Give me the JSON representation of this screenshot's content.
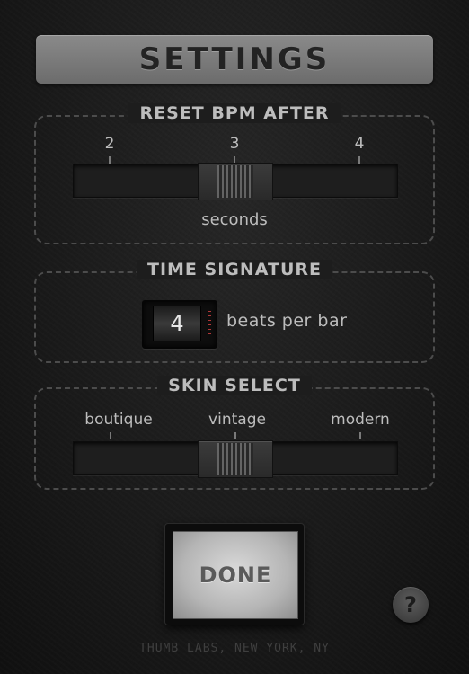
{
  "title": "SETTINGS",
  "reset_bpm": {
    "label": "RESET BPM AFTER",
    "ticks": [
      "2",
      "3",
      "4"
    ],
    "selected": "3",
    "caption": "seconds"
  },
  "time_signature": {
    "label": "TIME SIGNATURE",
    "value": "4",
    "caption": "beats per bar"
  },
  "skin_select": {
    "label": "SKIN SELECT",
    "options": [
      "boutique",
      "vintage",
      "modern"
    ],
    "selected": "vintage"
  },
  "done_label": "DONE",
  "help_label": "?",
  "footer": "THUMB LABS, NEW YORK, NY",
  "icons": {
    "help": "question-mark-icon",
    "slider_thumb": "grip-handle-icon"
  },
  "colors": {
    "background": "#1a1a1a",
    "title_bar": "#7a7a7a",
    "text": "#bdbdbd",
    "counter_marks": "#b23838"
  }
}
